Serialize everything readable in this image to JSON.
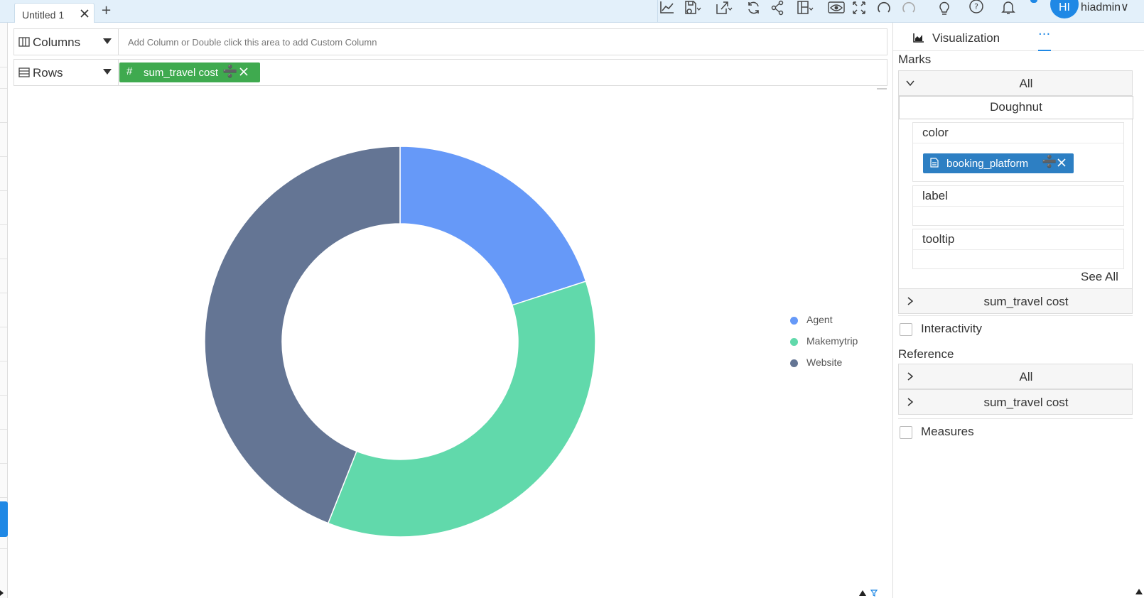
{
  "tab": {
    "title": "Untitled 1",
    "add_symbol": "+"
  },
  "user": {
    "initials": "HI",
    "name": "hiadmin∨"
  },
  "toolbar": {
    "icons": [
      "chart-line-icon",
      "save-icon",
      "export-icon",
      "refresh-icon",
      "share-icon",
      "layout-icon",
      "preview-eye-icon",
      "fullscreen-icon",
      "undo-icon",
      "redo-icon",
      "bulb-icon",
      "help-icon",
      "bell-icon"
    ]
  },
  "shelves": {
    "columns": {
      "title": "Columns",
      "hint": "Add Column or Double click this area to add Custom Column"
    },
    "rows": {
      "title": "Rows",
      "pill": {
        "symbol": "#",
        "label": "sum_travel cost",
        "divide": "➗"
      }
    }
  },
  "chart_data": {
    "type": "pie",
    "variant": "doughnut",
    "categories": [
      "Agent",
      "Makemytrip",
      "Website"
    ],
    "values": [
      20,
      36,
      44
    ],
    "colors": [
      "#6699f8",
      "#61d9ab",
      "#647594"
    ],
    "legend_position": "right"
  },
  "panel": {
    "title": "Visualization",
    "more": "···",
    "marks_label": "Marks",
    "marks_all": "All",
    "chart_type": "Doughnut",
    "props": {
      "color": "color",
      "label": "label",
      "tooltip": "tooltip"
    },
    "color_pill": {
      "label": "booking_platform",
      "divide": "➗"
    },
    "see_all": "See All",
    "measure_row": "sum_travel cost",
    "interactivity": "Interactivity",
    "reference_label": "Reference",
    "reference_all": "All",
    "reference_measure": "sum_travel cost",
    "measures": "Measures"
  }
}
